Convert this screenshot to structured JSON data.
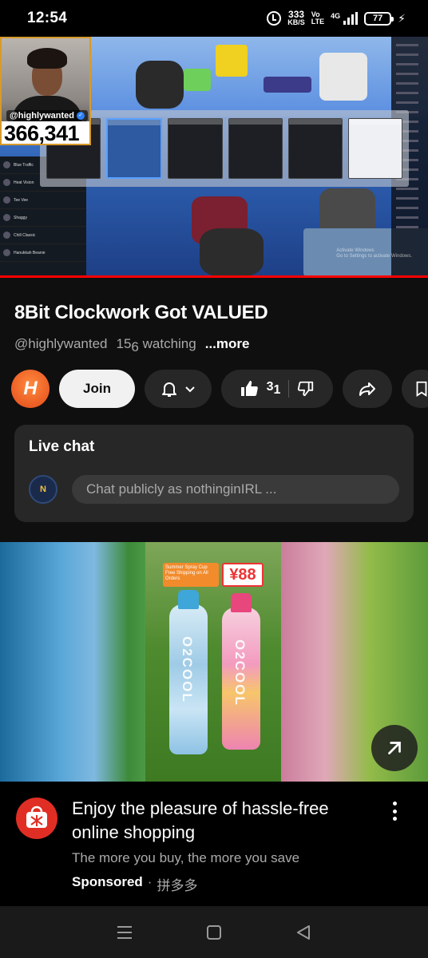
{
  "status_bar": {
    "time": "12:54",
    "speed_value": "333",
    "speed_unit": "KB/S",
    "volte_top": "Vo",
    "volte_bottom": "LTE",
    "network": "4G",
    "battery": "77"
  },
  "video": {
    "streamer_handle": "@highlywanted",
    "subscriber_count": "366,341",
    "activate_windows_line1": "Activate Windows",
    "activate_windows_line2": "Go to Settings to activate Windows.",
    "leaderboard": [
      "Blue Traffic",
      "Heat Vision",
      "Tee Vee",
      "Shaggy",
      "Chill Classic",
      "Hanukkah Beanie"
    ],
    "progress": 1.0
  },
  "title": "8Bit Clockwork Got VALUED",
  "channel_handle": "@highlywanted",
  "watching_prefix": "15",
  "watching_sub": "6",
  "watching_suffix": " watching",
  "more_label": "...more",
  "actions": {
    "channel_avatar_letter": "H",
    "join_label": "Join",
    "like_count_prefix": "3",
    "like_count_sub": "1"
  },
  "live_chat": {
    "title": "Live chat",
    "avatar_text": "N",
    "placeholder": "Chat publicly as nothinginIRL ..."
  },
  "ad": {
    "banner_text": "Summer Spray Cup  Free Shipping on All Orders",
    "price": "¥88",
    "bottle_brand": "O2COOL",
    "title": "Enjoy the pleasure of hassle-free online shopping",
    "description": "The more you buy, the more you save",
    "sponsored_label": "Sponsored",
    "separator": "·",
    "advertiser": "拼多多"
  },
  "icons": [
    "alarm-icon",
    "signal-icon",
    "battery-icon",
    "bell-icon",
    "chevron-down-icon",
    "thumbs-up-icon",
    "thumbs-down-icon",
    "share-icon",
    "save-icon",
    "external-link-icon",
    "more-vert-icon",
    "recents-icon",
    "home-icon",
    "back-icon"
  ],
  "colors": {
    "background": "#0f0f0f",
    "pill": "#272727",
    "progress": "#ff0000",
    "advertiser": "#e02e24"
  }
}
